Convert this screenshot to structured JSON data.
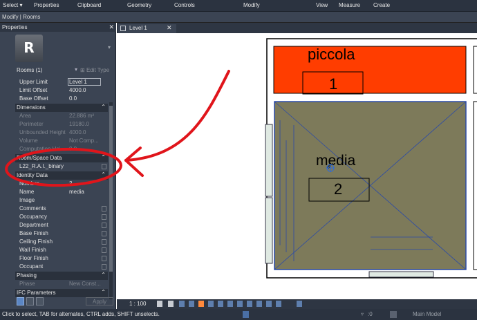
{
  "ribbon": {
    "select": "Select",
    "select_caret": "▾",
    "tabs": [
      "Properties",
      "Clipboard",
      "Geometry",
      "Controls",
      "Modify",
      "View",
      "Measure",
      "Create"
    ]
  },
  "mode": "Modify | Rooms",
  "properties": {
    "title": "Properties",
    "close": "✕",
    "logo": "R",
    "selector": "Rooms (1)",
    "edit_type": "Edit Type",
    "constraints": [
      {
        "k": "Upper Limit",
        "v": "Level 1"
      },
      {
        "k": "Limit Offset",
        "v": "4000.0"
      },
      {
        "k": "Base Offset",
        "v": "0.0"
      }
    ],
    "dimensions_title": "Dimensions",
    "dimensions": [
      {
        "k": "Area",
        "v": "22.886 m²"
      },
      {
        "k": "Perimeter",
        "v": "19180.0"
      },
      {
        "k": "Unbounded Height",
        "v": "4000.0"
      },
      {
        "k": "Volume",
        "v": "Not Comp..."
      },
      {
        "k": "Computation Hei...",
        "v": "0.0"
      }
    ],
    "room_space_title": "Room/Space Data",
    "room_space": [
      {
        "k": "L22_R.A.I._binary",
        "v": ""
      }
    ],
    "identity_title": "Identity Data",
    "identity": [
      {
        "k": "Number",
        "v": "2"
      },
      {
        "k": "Name",
        "v": "media"
      },
      {
        "k": "Image",
        "v": ""
      },
      {
        "k": "Comments",
        "v": ""
      },
      {
        "k": "Occupancy",
        "v": ""
      },
      {
        "k": "Department",
        "v": ""
      },
      {
        "k": "Base Finish",
        "v": ""
      },
      {
        "k": "Ceiling Finish",
        "v": ""
      },
      {
        "k": "Wall Finish",
        "v": ""
      },
      {
        "k": "Floor Finish",
        "v": ""
      },
      {
        "k": "Occupant",
        "v": ""
      }
    ],
    "phasing_title": "Phasing",
    "phasing": [
      {
        "k": "Phase",
        "v": "New Const..."
      }
    ],
    "ifc_title": "IFC Parameters",
    "apply": "Apply"
  },
  "view_tab": {
    "label": "Level 1",
    "close": "✕"
  },
  "plan": {
    "room1_name": "piccola",
    "room1_number": "1",
    "room2_name": "media",
    "room2_number": "2",
    "room1_color": "#ff3d00",
    "room2_color": "#7d7a5a",
    "annotation_color": "#e0151b"
  },
  "view_bar": {
    "scale": "1 : 100"
  },
  "status": {
    "message": "Click to select, TAB for alternates, CTRL adds, SHIFT unselects.",
    "zero": ":0",
    "model": "Main Model"
  }
}
